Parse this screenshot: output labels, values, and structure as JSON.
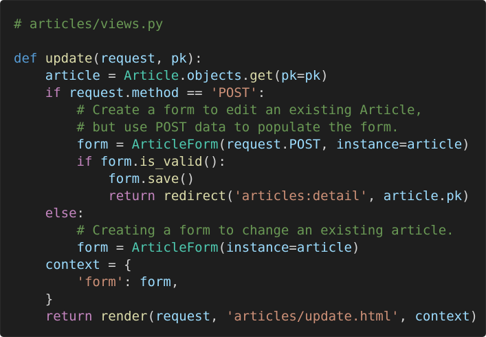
{
  "editor": {
    "language": "python",
    "colors": {
      "background": "#1e1e1e",
      "comment": "#6a9955",
      "keyword": "#569cd6",
      "control": "#c586c0",
      "function": "#dcdcaa",
      "class": "#4ec9b0",
      "variable": "#9cdcfe",
      "string": "#ce9178",
      "plain": "#d4d4d4"
    },
    "lines": [
      [
        {
          "t": "# articles/views.py",
          "c": "comment"
        }
      ],
      [],
      [
        {
          "t": "def",
          "c": "keyword"
        },
        {
          "t": " ",
          "c": "plain"
        },
        {
          "t": "update",
          "c": "function"
        },
        {
          "t": "(",
          "c": "punct"
        },
        {
          "t": "request",
          "c": "variable"
        },
        {
          "t": ", ",
          "c": "punct"
        },
        {
          "t": "pk",
          "c": "variable"
        },
        {
          "t": "):",
          "c": "punct"
        }
      ],
      [
        {
          "t": "    ",
          "c": "plain"
        },
        {
          "t": "article",
          "c": "variable"
        },
        {
          "t": " = ",
          "c": "operator"
        },
        {
          "t": "Article",
          "c": "class"
        },
        {
          "t": ".",
          "c": "punct"
        },
        {
          "t": "objects",
          "c": "variable"
        },
        {
          "t": ".",
          "c": "punct"
        },
        {
          "t": "get",
          "c": "function"
        },
        {
          "t": "(",
          "c": "punct"
        },
        {
          "t": "pk",
          "c": "variable"
        },
        {
          "t": "=",
          "c": "operator"
        },
        {
          "t": "pk",
          "c": "variable"
        },
        {
          "t": ")",
          "c": "punct"
        }
      ],
      [
        {
          "t": "    ",
          "c": "plain"
        },
        {
          "t": "if",
          "c": "control"
        },
        {
          "t": " ",
          "c": "plain"
        },
        {
          "t": "request",
          "c": "variable"
        },
        {
          "t": ".",
          "c": "punct"
        },
        {
          "t": "method",
          "c": "variable"
        },
        {
          "t": " == ",
          "c": "operator"
        },
        {
          "t": "'POST'",
          "c": "string"
        },
        {
          "t": ":",
          "c": "punct"
        }
      ],
      [
        {
          "t": "        ",
          "c": "plain"
        },
        {
          "t": "# Create a form to edit an existing Article,",
          "c": "comment"
        }
      ],
      [
        {
          "t": "        ",
          "c": "plain"
        },
        {
          "t": "# but use POST data to populate the form.",
          "c": "comment"
        }
      ],
      [
        {
          "t": "        ",
          "c": "plain"
        },
        {
          "t": "form",
          "c": "variable"
        },
        {
          "t": " = ",
          "c": "operator"
        },
        {
          "t": "ArticleForm",
          "c": "class"
        },
        {
          "t": "(",
          "c": "punct"
        },
        {
          "t": "request",
          "c": "variable"
        },
        {
          "t": ".",
          "c": "punct"
        },
        {
          "t": "POST",
          "c": "variable"
        },
        {
          "t": ", ",
          "c": "punct"
        },
        {
          "t": "instance",
          "c": "variable"
        },
        {
          "t": "=",
          "c": "operator"
        },
        {
          "t": "article",
          "c": "variable"
        },
        {
          "t": ")",
          "c": "punct"
        }
      ],
      [
        {
          "t": "        ",
          "c": "plain"
        },
        {
          "t": "if",
          "c": "control"
        },
        {
          "t": " ",
          "c": "plain"
        },
        {
          "t": "form",
          "c": "variable"
        },
        {
          "t": ".",
          "c": "punct"
        },
        {
          "t": "is_valid",
          "c": "function"
        },
        {
          "t": "():",
          "c": "punct"
        }
      ],
      [
        {
          "t": "            ",
          "c": "plain"
        },
        {
          "t": "form",
          "c": "variable"
        },
        {
          "t": ".",
          "c": "punct"
        },
        {
          "t": "save",
          "c": "function"
        },
        {
          "t": "()",
          "c": "punct"
        }
      ],
      [
        {
          "t": "            ",
          "c": "plain"
        },
        {
          "t": "return",
          "c": "control"
        },
        {
          "t": " ",
          "c": "plain"
        },
        {
          "t": "redirect",
          "c": "function"
        },
        {
          "t": "(",
          "c": "punct"
        },
        {
          "t": "'articles:detail'",
          "c": "string"
        },
        {
          "t": ", ",
          "c": "punct"
        },
        {
          "t": "article",
          "c": "variable"
        },
        {
          "t": ".",
          "c": "punct"
        },
        {
          "t": "pk",
          "c": "variable"
        },
        {
          "t": ")",
          "c": "punct"
        }
      ],
      [
        {
          "t": "    ",
          "c": "plain"
        },
        {
          "t": "else",
          "c": "control"
        },
        {
          "t": ":",
          "c": "punct"
        }
      ],
      [
        {
          "t": "        ",
          "c": "plain"
        },
        {
          "t": "# Creating a form to change an existing article.",
          "c": "comment"
        }
      ],
      [
        {
          "t": "        ",
          "c": "plain"
        },
        {
          "t": "form",
          "c": "variable"
        },
        {
          "t": " = ",
          "c": "operator"
        },
        {
          "t": "ArticleForm",
          "c": "class"
        },
        {
          "t": "(",
          "c": "punct"
        },
        {
          "t": "instance",
          "c": "variable"
        },
        {
          "t": "=",
          "c": "operator"
        },
        {
          "t": "article",
          "c": "variable"
        },
        {
          "t": ")",
          "c": "punct"
        }
      ],
      [
        {
          "t": "    ",
          "c": "plain"
        },
        {
          "t": "context",
          "c": "variable"
        },
        {
          "t": " = ",
          "c": "operator"
        },
        {
          "t": "{",
          "c": "punct"
        }
      ],
      [
        {
          "t": "        ",
          "c": "plain"
        },
        {
          "t": "'form'",
          "c": "string"
        },
        {
          "t": ": ",
          "c": "punct"
        },
        {
          "t": "form",
          "c": "variable"
        },
        {
          "t": ",",
          "c": "punct"
        }
      ],
      [
        {
          "t": "    ",
          "c": "plain"
        },
        {
          "t": "}",
          "c": "punct"
        }
      ],
      [
        {
          "t": "    ",
          "c": "plain"
        },
        {
          "t": "return",
          "c": "control"
        },
        {
          "t": " ",
          "c": "plain"
        },
        {
          "t": "render",
          "c": "function"
        },
        {
          "t": "(",
          "c": "punct"
        },
        {
          "t": "request",
          "c": "variable"
        },
        {
          "t": ", ",
          "c": "punct"
        },
        {
          "t": "'articles/update.html'",
          "c": "string"
        },
        {
          "t": ", ",
          "c": "punct"
        },
        {
          "t": "context",
          "c": "variable"
        },
        {
          "t": ")",
          "c": "punct"
        }
      ]
    ]
  }
}
